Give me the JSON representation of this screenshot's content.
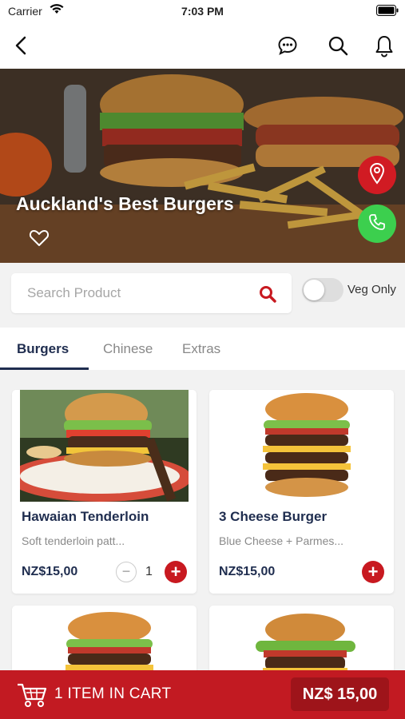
{
  "status_bar": {
    "carrier": "Carrier",
    "time": "7:03 PM"
  },
  "nav": {
    "icons": [
      "back-icon",
      "chat-icon",
      "search-icon",
      "bell-icon"
    ]
  },
  "hero": {
    "title": "Auckland's Best Burgers",
    "icons": [
      "heart-icon",
      "location-pin-icon",
      "phone-icon"
    ]
  },
  "search": {
    "placeholder": "Search Product",
    "value": ""
  },
  "filter": {
    "veg_only_label": "Veg Only",
    "veg_only_on": false
  },
  "tabs": [
    {
      "label": "Burgers",
      "active": true
    },
    {
      "label": "Chinese",
      "active": false
    },
    {
      "label": "Extras",
      "active": false
    }
  ],
  "products": [
    {
      "name": "Hawaian Tenderloin",
      "description": "Soft tenderloin patt...",
      "price": "NZ$15,00",
      "quantity": "1"
    },
    {
      "name": "3 Cheese Burger",
      "description": "Blue Cheese + Parmes...",
      "price": "NZ$15,00"
    },
    {
      "name": "",
      "description": "",
      "price": ""
    },
    {
      "name": "",
      "description": "",
      "price": ""
    }
  ],
  "cart": {
    "label": "1 ITEM  IN CART",
    "total": "NZ$ 15,00"
  },
  "colors": {
    "brand_red": "#c21a22",
    "navy": "#1f2d4f",
    "call_green": "#3ccf4e"
  }
}
